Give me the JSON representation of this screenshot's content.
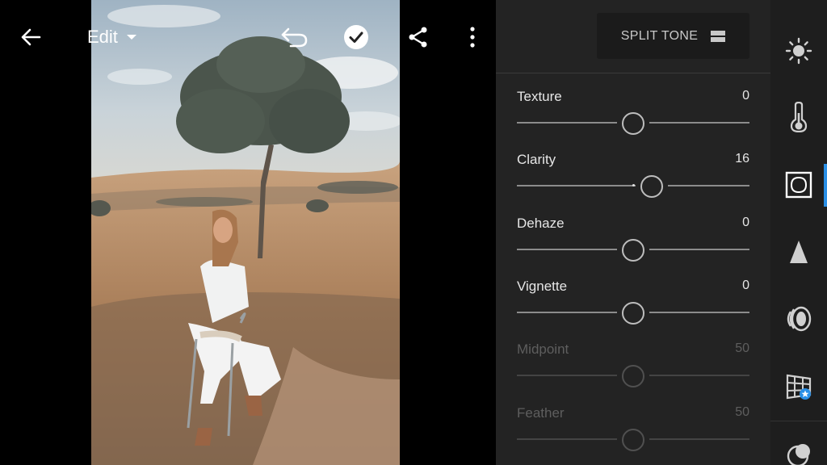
{
  "topbar": {
    "back_icon": "arrow-left-icon",
    "edit_label": "Edit",
    "undo_icon": "undo-icon",
    "done_icon": "check-circle-icon",
    "share_icon": "share-icon",
    "more_icon": "more-vertical-icon"
  },
  "panel": {
    "split_tone_label": "SPLIT TONE",
    "sliders": [
      {
        "label": "Texture",
        "value": "0",
        "position": 0.5,
        "enabled": true
      },
      {
        "label": "Clarity",
        "value": "16",
        "position": 0.58,
        "enabled": true
      },
      {
        "label": "Dehaze",
        "value": "0",
        "position": 0.5,
        "enabled": true
      },
      {
        "label": "Vignette",
        "value": "0",
        "position": 0.5,
        "enabled": true
      },
      {
        "label": "Midpoint",
        "value": "50",
        "position": 0.5,
        "enabled": false
      },
      {
        "label": "Feather",
        "value": "50",
        "position": 0.5,
        "enabled": false
      }
    ]
  },
  "rail": {
    "items": [
      "light-icon",
      "color-temperature-icon",
      "effects-icon",
      "detail-icon",
      "optics-icon",
      "geometry-icon",
      "mask-icon"
    ],
    "active_index": 2,
    "accent_color": "#2a8fe6"
  }
}
